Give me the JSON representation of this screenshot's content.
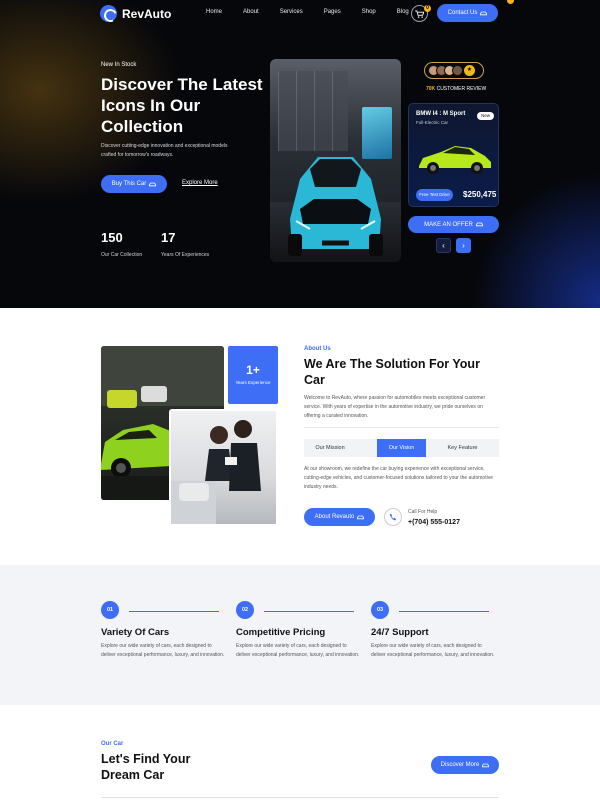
{
  "brand": {
    "name": "RevAuto",
    "accent": "#3d6ef5",
    "gold": "#f6b519"
  },
  "nav": {
    "items": [
      "Home",
      "About",
      "Services",
      "Pages",
      "Shop",
      "Blog"
    ]
  },
  "header": {
    "cart_count": "0",
    "cart_icon": "cart-icon",
    "contact_label": "Contact Us"
  },
  "hero": {
    "kicker": "New In Stock",
    "title": "Discover The Latest Icons In Our Collection",
    "description": "Discover cutting-edge innovation and exceptional models crafted for tomorrow's roadways.",
    "buy_label": "Buy This Car",
    "explore_label": "Explore More",
    "stats": [
      {
        "value": "150",
        "label": "Our Car Collection"
      },
      {
        "value": "17",
        "label": "Years Of Experiences"
      }
    ]
  },
  "reviews": {
    "count": "70K",
    "label": "CUSTOMER REVIEW",
    "star": "★"
  },
  "car_card": {
    "name": "BMW I4 : M Sport",
    "subtitle": "Full-Electric Car",
    "badge": "New",
    "test_drive_label": "Free Test Drive",
    "price": "$250,475",
    "offer_label": "MAKE AN OFFER",
    "prev_icon": "‹",
    "next_icon": "›"
  },
  "about": {
    "years_value": "1+",
    "years_label": "Years Experience",
    "kicker": "About Us",
    "title": "We Are The Solution For Your Car",
    "description": "Welcome to RevAuto, where passion for automobiles meets exceptional customer service. With years of expertise in the automotive industry, we pride ourselves on offering a curated innovation.",
    "tabs": [
      {
        "label": "Our Mission",
        "active": false
      },
      {
        "label": "Our Vision",
        "active": true
      },
      {
        "label": "Key Feature",
        "active": false
      }
    ],
    "tab_text": "At our showroom, we redefine the car buying experience with exceptional service, cutting-edge vehicles, and customer-focused solutions tailored to your the automotive industry needs.",
    "button_label": "About Revauto",
    "call_label": "Call For Help",
    "phone": "+(704) 555-0127"
  },
  "features": [
    {
      "num": "01",
      "title": "Variety Of Cars",
      "desc": "Explore our wide variety of cars, each designed to deliver exceptional performance, luxury, and innovation."
    },
    {
      "num": "02",
      "title": "Competitive Pricing",
      "desc": "Explore our wide variety of cars, each designed to deliver exceptional performance, luxury, and innovation."
    },
    {
      "num": "03",
      "title": "24/7 Support",
      "desc": "Explore our wide variety of cars, each designed to deliver exceptional performance, luxury, and innovation."
    }
  ],
  "find_car": {
    "kicker": "Our Car",
    "title": "Let's Find Your Dream Car",
    "button_label": "Discover More"
  }
}
